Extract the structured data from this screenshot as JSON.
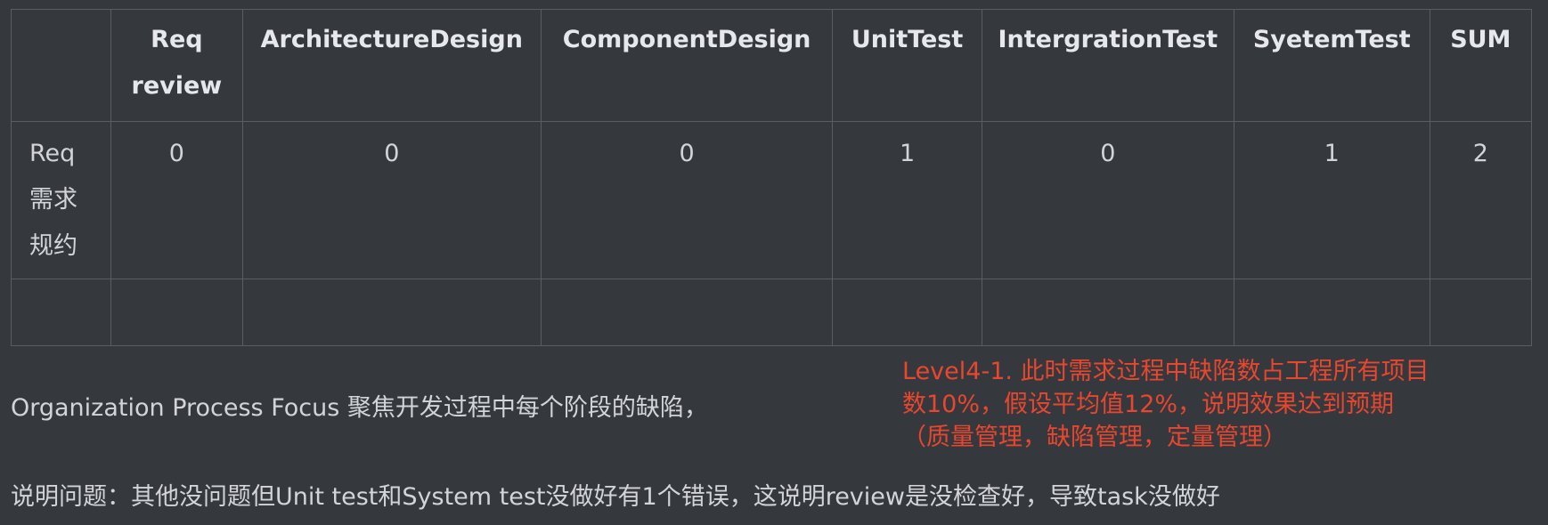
{
  "table": {
    "headers": [
      "",
      [
        "Req",
        "review"
      ],
      "ArchitectureDesign",
      "ComponentDesign",
      "UnitTest",
      "IntergrationTest",
      "SyetemTest",
      "SUM"
    ],
    "row_label": [
      "Req",
      "需求",
      "规约"
    ],
    "values": [
      "0",
      "0",
      "0",
      "1",
      "0",
      "1",
      "2"
    ]
  },
  "focus_text": "Organization Process Focus 聚焦开发过程中每个阶段的缺陷，",
  "level_note": [
    "Level4-1. 此时需求过程中缺陷数占工程所有项目",
    "数10%，假设平均值12%，说明效果达到预期",
    "（质量管理，缺陷管理，定量管理）"
  ],
  "problem_text": "说明问题：其他没问题但Unit test和System test没做好有1个错误，这说明review是没检查好，导致task没做好",
  "colors": {
    "background": "#35383d",
    "text": "#d2d4d8",
    "accent_red": "#e8472f",
    "grid": "#5a5e64"
  }
}
